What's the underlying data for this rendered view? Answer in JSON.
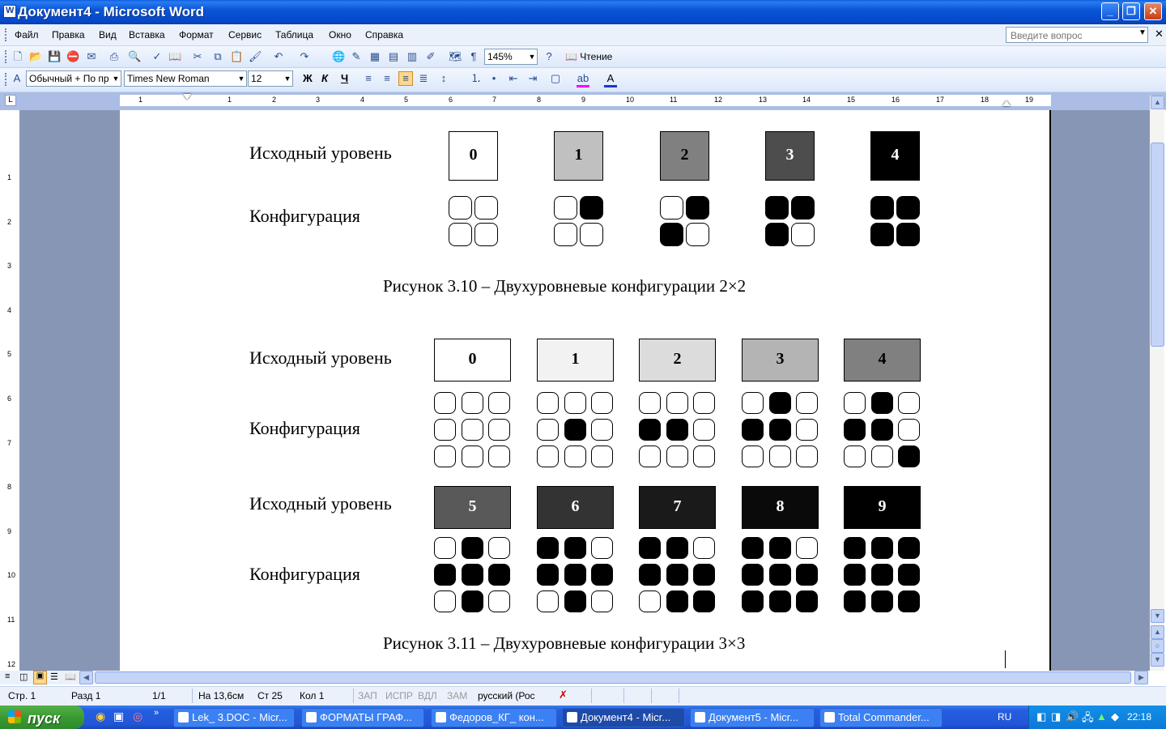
{
  "window": {
    "title": "Документ4 - Microsoft Word"
  },
  "menu": [
    "Файл",
    "Правка",
    "Вид",
    "Вставка",
    "Формат",
    "Сервис",
    "Таблица",
    "Окно",
    "Справка"
  ],
  "help_placeholder": "Введите вопрос",
  "toolbar_standard": {
    "zoom": "145%",
    "reading_label": "Чтение"
  },
  "toolbar_format": {
    "style": "Обычный + По пр",
    "font": "Times New Roman",
    "size": "12",
    "bold": "Ж",
    "italic": "К",
    "underline": "Ч"
  },
  "ruler_numbers": [
    "1",
    "1",
    "2",
    "3",
    "4",
    "5",
    "6",
    "7",
    "8",
    "9",
    "10",
    "11",
    "12",
    "13",
    "14",
    "15",
    "16",
    "17",
    "18",
    "19"
  ],
  "vruler_numbers": [
    "1",
    "2",
    "3",
    "4",
    "5",
    "6",
    "7",
    "8",
    "9",
    "10",
    "11",
    "12"
  ],
  "fig1": {
    "row_label_level": "Исходный уровень",
    "row_label_config": "Конфигурация",
    "levels": [
      "0",
      "1",
      "2",
      "3",
      "4"
    ],
    "level_colors": [
      "#ffffff",
      "#c0c0c0",
      "#808080",
      "#4d4d4d",
      "#000000"
    ],
    "level_text_colors": [
      "#000000",
      "#000000",
      "#000000",
      "#ffffff",
      "#ffffff"
    ],
    "configs": [
      [
        0,
        0,
        0,
        0
      ],
      [
        0,
        1,
        0,
        0
      ],
      [
        0,
        1,
        1,
        0
      ],
      [
        1,
        1,
        1,
        0
      ],
      [
        1,
        1,
        1,
        1
      ]
    ],
    "caption": "Рисунок 3.10 – Двухуровневые конфигурации 2×2"
  },
  "fig2": {
    "row_label_level": "Исходный уровень",
    "row_label_config": "Конфигурация",
    "levels_a": [
      "0",
      "1",
      "2",
      "3",
      "4"
    ],
    "level_colors_a": [
      "#ffffff",
      "#f2f2f2",
      "#dcdcdc",
      "#b4b4b4",
      "#808080"
    ],
    "level_text_colors_a": [
      "#000000",
      "#000000",
      "#000000",
      "#000000",
      "#000000"
    ],
    "configs_a": [
      [
        0,
        0,
        0,
        0,
        0,
        0,
        0,
        0,
        0
      ],
      [
        0,
        0,
        0,
        0,
        1,
        0,
        0,
        0,
        0
      ],
      [
        0,
        0,
        0,
        1,
        1,
        0,
        0,
        0,
        0
      ],
      [
        0,
        1,
        0,
        1,
        1,
        0,
        0,
        0,
        0
      ],
      [
        0,
        1,
        0,
        1,
        1,
        0,
        0,
        0,
        1
      ]
    ],
    "levels_b": [
      "5",
      "6",
      "7",
      "8",
      "9"
    ],
    "level_colors_b": [
      "#595959",
      "#333333",
      "#1a1a1a",
      "#0a0a0a",
      "#000000"
    ],
    "level_text_colors_b": [
      "#ffffff",
      "#ffffff",
      "#ffffff",
      "#ffffff",
      "#ffffff"
    ],
    "configs_b": [
      [
        0,
        1,
        0,
        1,
        1,
        1,
        0,
        1,
        0
      ],
      [
        1,
        1,
        0,
        1,
        1,
        1,
        0,
        1,
        0
      ],
      [
        1,
        1,
        0,
        1,
        1,
        1,
        0,
        1,
        1
      ],
      [
        1,
        1,
        0,
        1,
        1,
        1,
        1,
        1,
        1
      ],
      [
        1,
        1,
        1,
        1,
        1,
        1,
        1,
        1,
        1
      ]
    ],
    "caption": "Рисунок 3.11 – Двухуровневые конфигурации 3×3"
  },
  "status": {
    "page": "Стр. 1",
    "section": "Разд 1",
    "pages": "1/1",
    "at": "На 13,6см",
    "line": "Ст 25",
    "col": "Кол 1",
    "rec": "ЗАП",
    "trk": "ИСПР",
    "ext": "ВДЛ",
    "ovr": "ЗАМ",
    "lang": "русский (Рос"
  },
  "taskbar": {
    "start": "пуск",
    "tasks": [
      "Lek_ 3.DOC - Micr...",
      "ФОРМАТЫ ГРАФ...",
      "Федоров_КГ_ кон...",
      "Документ4 - Micr...",
      "Документ5 - Micr...",
      "Total Commander..."
    ],
    "lang": "RU",
    "clock": "22:18"
  }
}
